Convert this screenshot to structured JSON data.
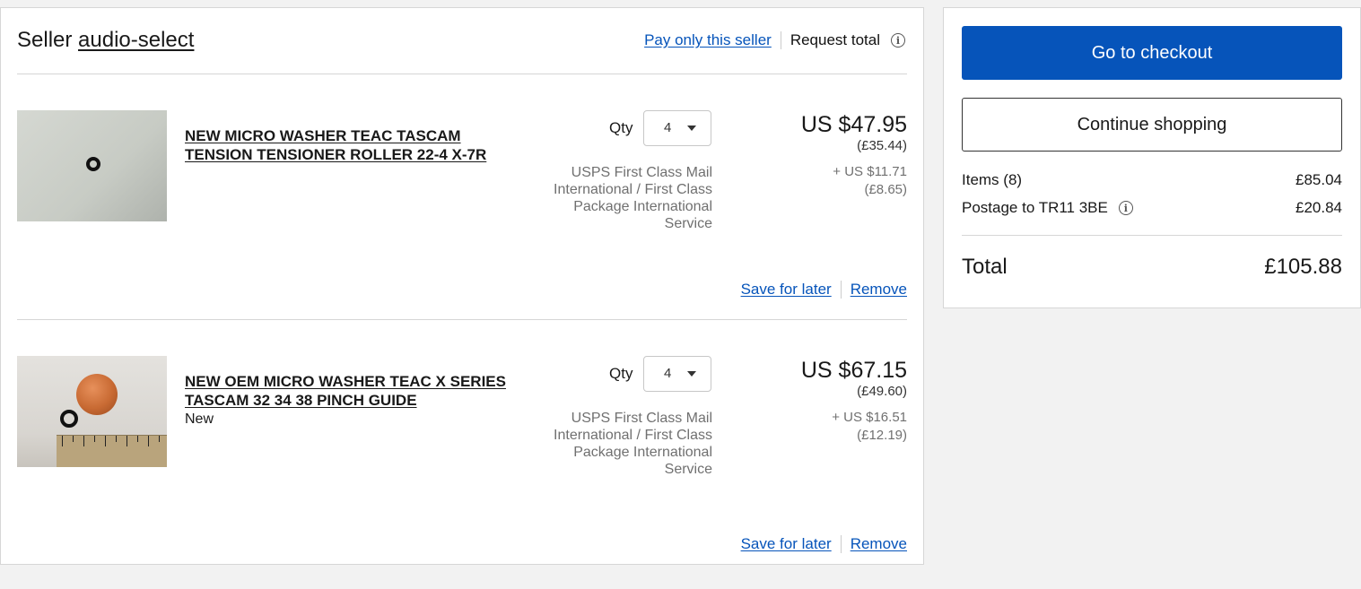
{
  "seller": {
    "prefix": "Seller",
    "name": "audio-select",
    "pay_only_label": "Pay only this seller",
    "request_total_label": "Request total",
    "info_icon": "info-icon"
  },
  "items": [
    {
      "title": "NEW MICRO WASHER TEAC TASCAM TENSION TENSIONER ROLLER 22-4 X-7R",
      "condition": "",
      "qty_label": "Qty",
      "qty_value": "4",
      "shipping": "USPS First Class Mail International / First Class Package International Service",
      "price": "US $47.95",
      "price_gbp": "(£35.44)",
      "postage_usd": "+ US $11.71",
      "postage_gbp": "(£8.65)",
      "save_label": "Save for later",
      "remove_label": "Remove"
    },
    {
      "title": "NEW OEM MICRO WASHER TEAC X SERIES TASCAM 32 34 38 PINCH GUIDE",
      "condition": "New",
      "qty_label": "Qty",
      "qty_value": "4",
      "shipping": "USPS First Class Mail International / First Class Package International Service",
      "price": "US $67.15",
      "price_gbp": "(£49.60)",
      "postage_usd": "+ US $16.51",
      "postage_gbp": "(£12.19)",
      "save_label": "Save for later",
      "remove_label": "Remove"
    }
  ],
  "summary": {
    "checkout_label": "Go to checkout",
    "continue_label": "Continue shopping",
    "items_label": "Items (8)",
    "items_amount": "£85.04",
    "postage_label": "Postage to TR11 3BE",
    "postage_amount": "£20.84",
    "total_label": "Total",
    "total_amount": "£105.88"
  },
  "colors": {
    "link": "#0654ba",
    "primary_button": "#0654ba",
    "background": "#f2f2f2"
  }
}
